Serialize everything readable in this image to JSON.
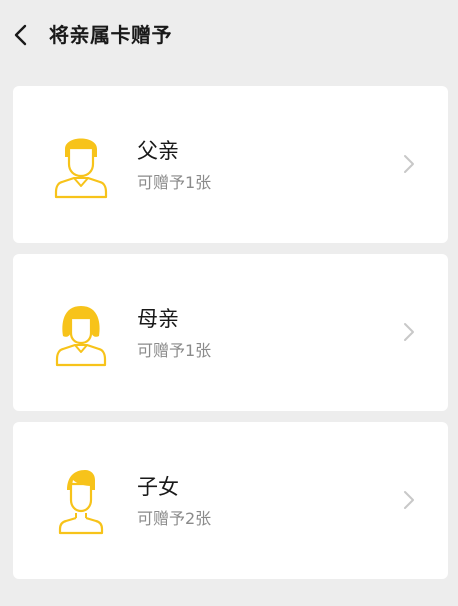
{
  "header": {
    "title": "将亲属卡赠予",
    "back_icon": "chevron-left-icon"
  },
  "accent_color": "#f7c31a",
  "relatives": [
    {
      "name": "父亲",
      "quota": "可赠予1张",
      "icon": "father-avatar-icon"
    },
    {
      "name": "母亲",
      "quota": "可赠予1张",
      "icon": "mother-avatar-icon"
    },
    {
      "name": "子女",
      "quota": "可赠予2张",
      "icon": "child-avatar-icon"
    }
  ]
}
